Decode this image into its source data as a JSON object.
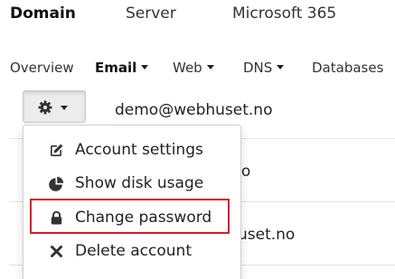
{
  "top_tabs": [
    {
      "label": "Domain"
    },
    {
      "label": "Server"
    },
    {
      "label": "Microsoft 365"
    }
  ],
  "sub_nav": [
    {
      "label": "Overview"
    },
    {
      "label": "Email"
    },
    {
      "label": "Web"
    },
    {
      "label": "DNS"
    },
    {
      "label": "Databases"
    }
  ],
  "account": {
    "email": "demo@webhuset.no"
  },
  "account_list": {
    "row2_visible_text": "t.no",
    "row3_visible_text": "uset.no"
  },
  "dropdown": {
    "items": [
      {
        "label": "Account settings",
        "icon": "edit-icon"
      },
      {
        "label": "Show disk usage",
        "icon": "pie-chart-icon"
      },
      {
        "label": "Change password",
        "icon": "lock-icon"
      },
      {
        "label": "Delete account",
        "icon": "close-icon"
      }
    ],
    "highlighted_item": "Change password",
    "highlight_color": "#d31f2a"
  }
}
